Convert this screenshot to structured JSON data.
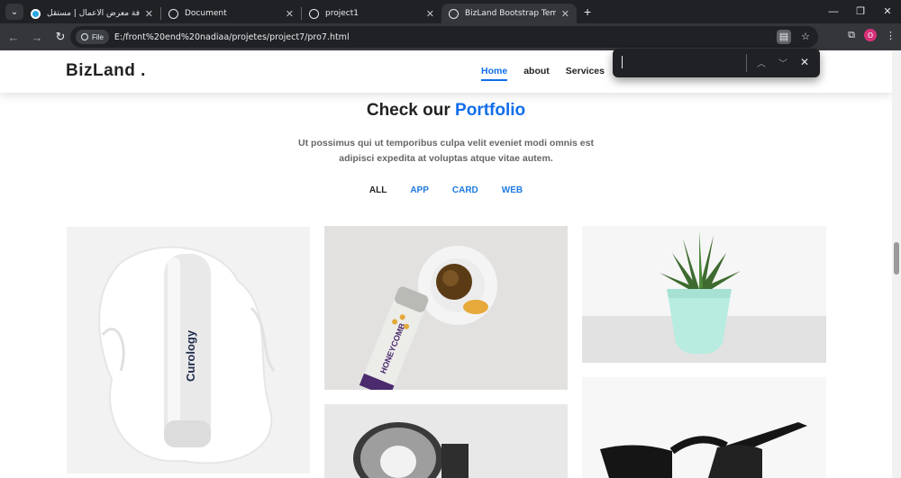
{
  "browser": {
    "tabs": [
      {
        "title": "إضافة معرض الأعمال | مستقل",
        "active": false
      },
      {
        "title": "Document",
        "active": false
      },
      {
        "title": "project1",
        "active": false
      },
      {
        "title": "BizLand Bootstrap Template De",
        "active": true
      }
    ],
    "url_chip": "File",
    "url": "E:/front%20end%20nadiaa/projetes/project7/pro7.html",
    "avatar_letter": "o"
  },
  "site": {
    "logo": "BizLand .",
    "nav": [
      "Home",
      "about",
      "Services"
    ],
    "section_title_prefix": "Check our",
    "section_title_highlight": "Portfolio",
    "subtitle": "Ut possimus qui ut temporibus culpa velit eveniet modi omnis est adipisci expedita at voluptas atque vitae autem.",
    "filters": [
      "ALL",
      "APP",
      "CARD",
      "WEB"
    ],
    "product_texts": {
      "bottle": "Curology",
      "can": "HONEYCOMB"
    }
  },
  "colors": {
    "accent": "#106eea",
    "chrome_dark": "#202124",
    "chrome_mid": "#35363a"
  }
}
